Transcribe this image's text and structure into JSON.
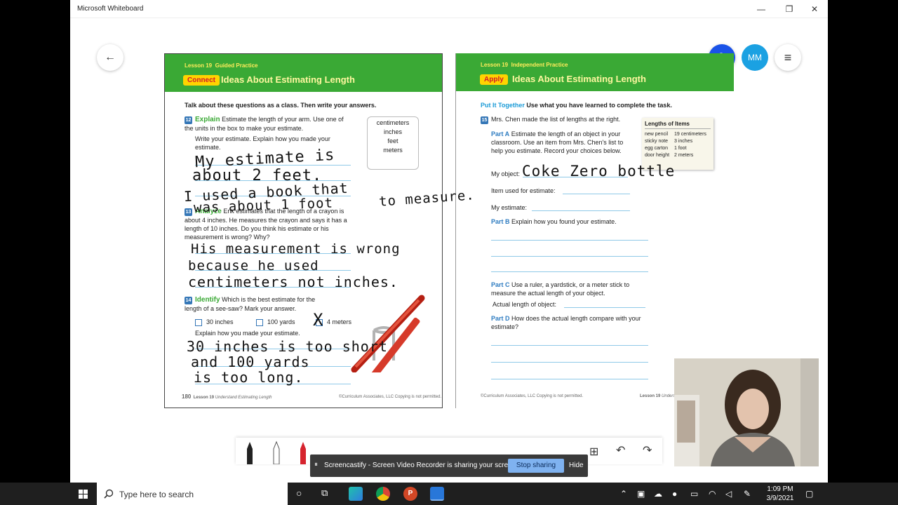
{
  "window": {
    "title": "Microsoft Whiteboard",
    "minimize": "—",
    "maximize": "❐",
    "close": "✕"
  },
  "whiteboard": {
    "back_icon": "←",
    "avatar_initials": "MM",
    "menu_icon": "≡",
    "colors": {
      "accent": "#1a53e8",
      "avatar": "#1ba1e2",
      "banner": "#3aa935"
    }
  },
  "left_page": {
    "lesson": "Lesson 19",
    "section": "Guided Practice",
    "tag": "Connect",
    "heading": "Ideas About Estimating Length",
    "intro": "Talk about these questions as a class. Then write your answers.",
    "q12": {
      "num": "12",
      "keyword": "Explain",
      "text": "Estimate the length of your arm. Use one of the units in the box to make your estimate.",
      "prompt": "Write your estimate. Explain how you made your estimate."
    },
    "units": [
      "centimeters",
      "inches",
      "feet",
      "meters"
    ],
    "q13": {
      "num": "13",
      "keyword": "Analyze",
      "text": "Erik estimates that the length of a crayon is about 4 inches. He measures the crayon and says it has a length of 10 inches. Do you think his estimate or his measurement is wrong? Why?"
    },
    "q14": {
      "num": "14",
      "keyword": "Identify",
      "text": "Which is the best estimate for the length of a see-saw? Mark your answer.",
      "options": [
        "30 inches",
        "100 yards",
        "4 meters"
      ],
      "prompt": "Explain how you made your estimate."
    },
    "footer": {
      "page": "180",
      "lesson": "Lesson 19",
      "title": "Understand Estimating Length",
      "copyright": "©Curriculum Associates, LLC   Copying is not permitted."
    }
  },
  "right_page": {
    "lesson": "Lesson 19",
    "section": "Independent Practice",
    "tag": "Apply",
    "heading": "Ideas About Estimating Length",
    "intro_kw": "Put It Together",
    "intro": "Use what you have learned to complete the task.",
    "q15": {
      "num": "15",
      "text": "Mrs. Chen made the list of lengths at the right."
    },
    "part_a": {
      "label": "Part A",
      "text": "Estimate the length of an object in your classroom. Use an item from Mrs. Chen's list to help you estimate. Record your choices below."
    },
    "fields": {
      "object": "My object:",
      "item": "Item used for estimate:",
      "estimate": "My estimate:",
      "actual": "Actual length of object:"
    },
    "part_b": {
      "label": "Part B",
      "text": "Explain how you found your estimate."
    },
    "part_c": {
      "label": "Part C",
      "text": "Use a ruler, a yardstick, or a meter stick to measure the actual length of your object."
    },
    "part_d": {
      "label": "Part D",
      "text": "How does the actual length compare with your estimate?"
    },
    "list": {
      "title": "Lengths of Items",
      "items": [
        {
          "name": "new pencil",
          "length": "19 centimeters"
        },
        {
          "name": "sticky note",
          "length": "3 inches"
        },
        {
          "name": "egg carton",
          "length": "1 foot"
        },
        {
          "name": "door height",
          "length": "2 meters"
        }
      ]
    },
    "footer": {
      "copyright": "©Curriculum Associates, LLC   Copying is not permitted.",
      "lesson": "Lesson 19",
      "title": "Understand"
    }
  },
  "ink": {
    "line1": "My estimate is",
    "line2": "about 2 feet.",
    "line3": "I used a book that",
    "line4": "was about 1 foot",
    "line5": "to measure.",
    "line6": "His measurement is wrong",
    "line7": "because he used",
    "line8": "centimeters not inches.",
    "line9": "30 inches is too short",
    "line10": "and 100 yards",
    "line11": "is too long.",
    "object_answer": "Coke Zero bottle",
    "cross": "X"
  },
  "share_bar": {
    "pause_icon": "⏸",
    "message": "Screencastify - Screen Video Recorder is sharing your screen.",
    "stop": "Stop sharing",
    "hide": "Hide"
  },
  "taskbar": {
    "search_placeholder": "Type here to search",
    "time": "1:09 PM",
    "date": "3/9/2021"
  }
}
